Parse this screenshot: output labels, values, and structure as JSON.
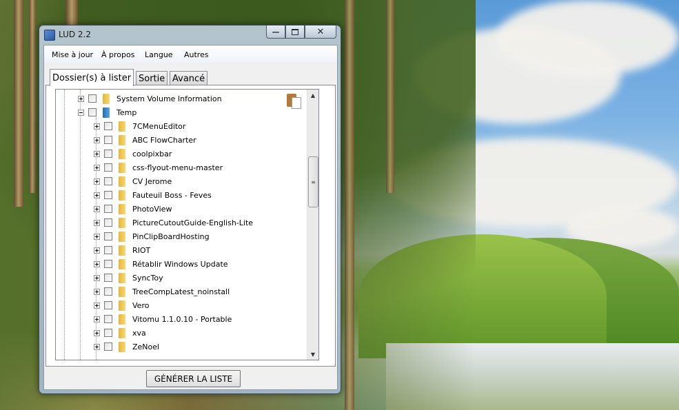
{
  "window": {
    "title": "LUD 2.2"
  },
  "menu": [
    "Mise à jour",
    "À propos",
    "Langue",
    "Autres"
  ],
  "tabs": [
    "Dossier(s) à lister",
    "Sortie",
    "Avancé"
  ],
  "tree": {
    "parent_items": [
      {
        "label": "System Volume Information",
        "expander": "plus",
        "icon": "folder-icon"
      },
      {
        "label": "Temp",
        "expander": "minus",
        "icon": "folder-blue-icon"
      }
    ],
    "child_items": [
      "7CMenuEditor",
      "ABC FlowCharter",
      "coolpixbar",
      "css-flyout-menu-master",
      "CV Jerome",
      "Fauteuil Boss - Feves",
      "PhotoView",
      "PictureCutoutGuide-English-Lite",
      "PinClipBoardHosting",
      "RIOT",
      "Rétablir Windows Update",
      "SyncToy",
      "TreeCompLatest_noinstall",
      "Vero",
      "Vitomu 1.1.0.10 - Portable",
      "xva",
      "ZeNoel"
    ]
  },
  "generate_button": "GÉNÉRER LA LISTE",
  "colors": {
    "folder": "#f0c550",
    "folder_blue": "#2a7dc4",
    "window_frame": "#b4c6d8"
  }
}
